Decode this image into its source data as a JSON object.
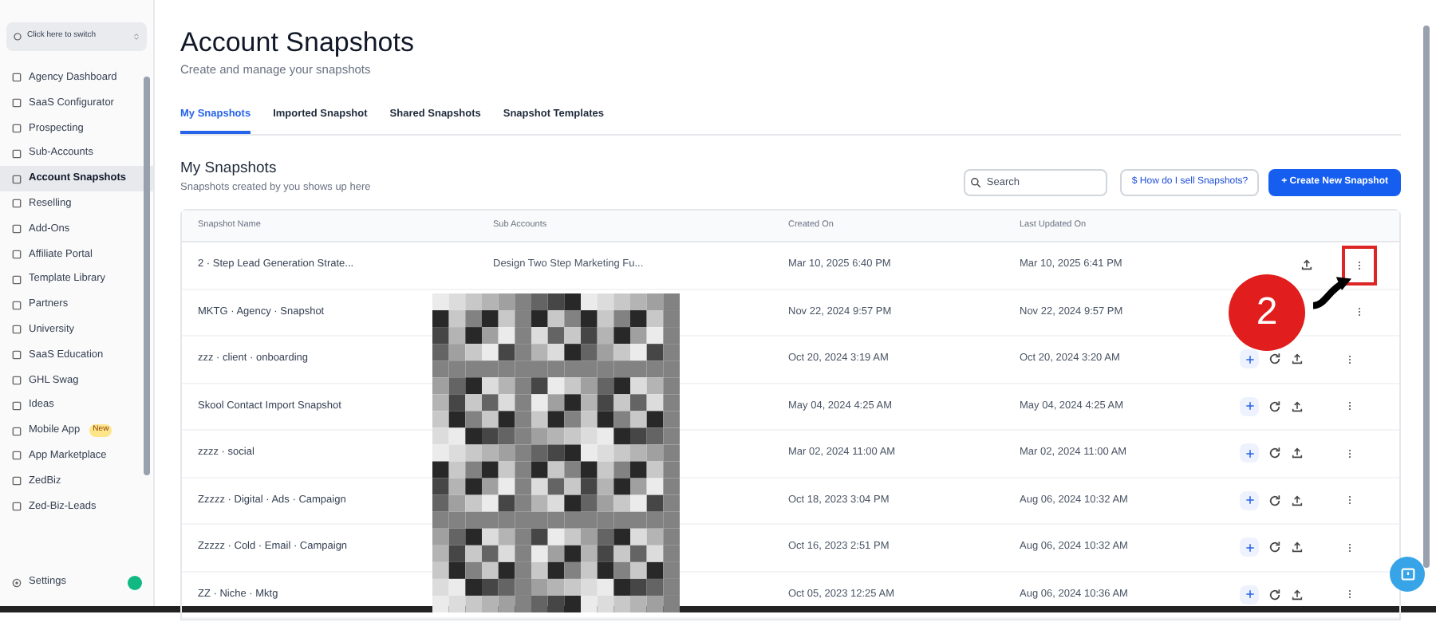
{
  "sidebar": {
    "switcher": "Click here to switch",
    "items": [
      {
        "label": "Agency Dashboard",
        "selected": false
      },
      {
        "label": "SaaS Configurator",
        "selected": false
      },
      {
        "label": "Prospecting",
        "selected": false
      },
      {
        "label": "Sub-Accounts",
        "selected": false
      },
      {
        "label": "Account Snapshots",
        "selected": true
      },
      {
        "label": "Reselling",
        "selected": false
      },
      {
        "label": "Add-Ons",
        "selected": false
      },
      {
        "label": "Affiliate Portal",
        "selected": false
      },
      {
        "label": "Template Library",
        "selected": false
      },
      {
        "label": "Partners",
        "selected": false
      },
      {
        "label": "University",
        "selected": false
      },
      {
        "label": "SaaS Education",
        "selected": false
      },
      {
        "label": "GHL Swag",
        "selected": false
      },
      {
        "label": "Ideas",
        "selected": false
      },
      {
        "label": "Mobile App",
        "selected": false,
        "badge": "New"
      },
      {
        "label": "App Marketplace",
        "selected": false
      },
      {
        "label": "ZedBiz",
        "selected": false
      },
      {
        "label": "Zed-Biz-Leads",
        "selected": false
      }
    ],
    "settings": "Settings"
  },
  "page": {
    "title": "Account Snapshots",
    "subtitle": "Create and manage your snapshots"
  },
  "tabs": [
    {
      "label": "My Snapshots",
      "selected": true
    },
    {
      "label": "Imported Snapshot",
      "selected": false
    },
    {
      "label": "Shared Snapshots",
      "selected": false
    },
    {
      "label": "Snapshot Templates",
      "selected": false
    }
  ],
  "section": {
    "title": "My Snapshots",
    "subtitle": "Snapshots created by you shows up here"
  },
  "search": {
    "placeholder": "Search"
  },
  "help_button": {
    "icon": "$",
    "label": "How do I sell Snapshots?"
  },
  "create_button": {
    "icon": "+",
    "label": "Create New Snapshot"
  },
  "table": {
    "columns": [
      "Snapshot Name",
      "Sub Accounts",
      "Created On",
      "Last Updated On"
    ],
    "rows": [
      {
        "name": "2 · Step Lead Generation Strate...",
        "sub_accounts": "Design Two Step Marketing Fu...",
        "created": "Mar 10, 2025 6:40 PM",
        "updated": "Mar 10, 2025 6:41 PM"
      },
      {
        "name": "MKTG · Agency · Snapshot",
        "created": "Nov 22, 2024 9:57 PM",
        "updated": "Nov 22, 2024 9:57 PM"
      },
      {
        "name": "zzz · client · onboarding",
        "created": "Oct 20, 2024 3:19 AM",
        "updated": "Oct 20, 2024 3:20 AM"
      },
      {
        "name": "Skool Contact Import Snapshot",
        "created": "May 04, 2024 4:25 AM",
        "updated": "May 04, 2024 4:25 AM"
      },
      {
        "name": "zzzz · social",
        "created": "Mar 02, 2024 11:00 AM",
        "updated": "Mar 02, 2024 11:00 AM"
      },
      {
        "name": "Zzzzz · Digital · Ads · Campaign",
        "created": "Oct 18, 2023 3:04 PM",
        "updated": "Aug 06, 2024 10:32 AM"
      },
      {
        "name": "Zzzzz · Cold · Email · Campaign",
        "created": "Oct 16, 2023 2:51 PM",
        "updated": "Aug 06, 2024 10:32 AM"
      },
      {
        "name": "ZZ · Niche · Mktg",
        "created": "Oct 05, 2023 12:25 AM",
        "updated": "Aug 06, 2024 10:36 AM"
      }
    ]
  },
  "annotation": {
    "number": "2"
  }
}
